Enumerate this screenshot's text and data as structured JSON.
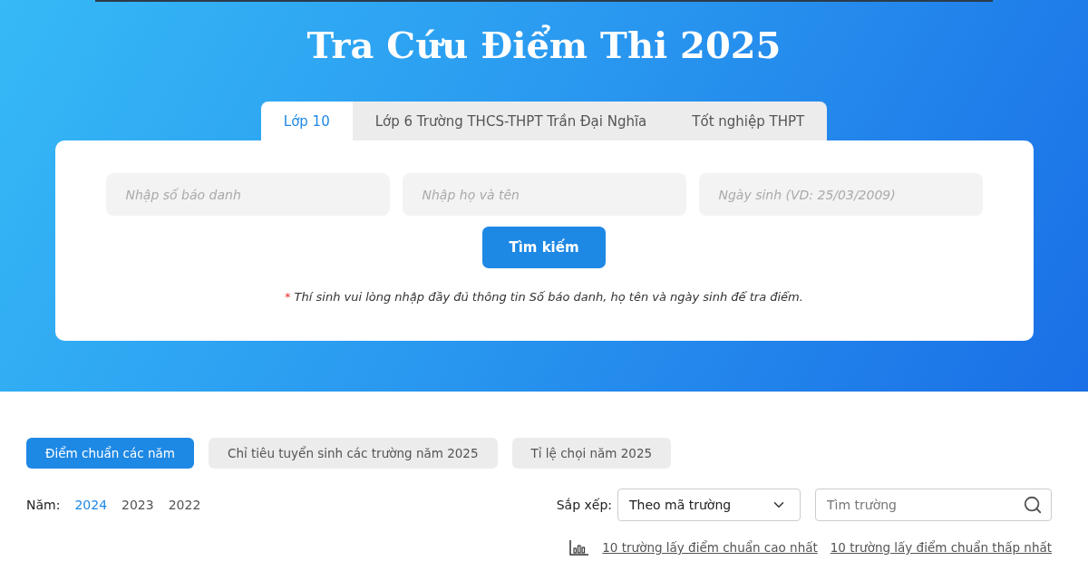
{
  "title": "Tra Cứu Điểm Thi 2025",
  "tabs": [
    {
      "label": "Lớp 10",
      "selected": true
    },
    {
      "label": "Lớp 6 Trường THCS-THPT Trần Đại Nghĩa",
      "selected": false
    },
    {
      "label": "Tốt nghiệp THPT",
      "selected": false
    }
  ],
  "fields": [
    {
      "placeholder": "Nhập số báo danh"
    },
    {
      "placeholder": "Nhập họ và tên"
    },
    {
      "placeholder": "Ngày sinh (VD: 25/03/2009)"
    }
  ],
  "search_button": "Tìm kiếm",
  "note": {
    "mark": "*",
    "text": "Thí sinh vui lòng nhập đầy đủ thông tin Số báo danh, họ tên và ngày sinh để tra điểm."
  },
  "filters": [
    {
      "label": "Điểm chuẩn các năm",
      "selected": true
    },
    {
      "label": "Chỉ tiêu tuyển sinh các trường năm 2025",
      "selected": false
    },
    {
      "label": "Tỉ lệ chọi năm 2025",
      "selected": false
    }
  ],
  "years": {
    "label": "Năm:",
    "items": [
      {
        "label": "2024",
        "selected": true
      },
      {
        "label": "2023",
        "selected": false
      },
      {
        "label": "2022",
        "selected": false
      }
    ]
  },
  "sort": {
    "label": "Sắp xếp:",
    "value": "Theo mã trường"
  },
  "school_search": {
    "placeholder": "Tìm trường"
  },
  "links": [
    "10 trường lấy điểm chuẩn cao nhất",
    "10 trường lấy điểm chuẩn thấp nhất"
  ]
}
